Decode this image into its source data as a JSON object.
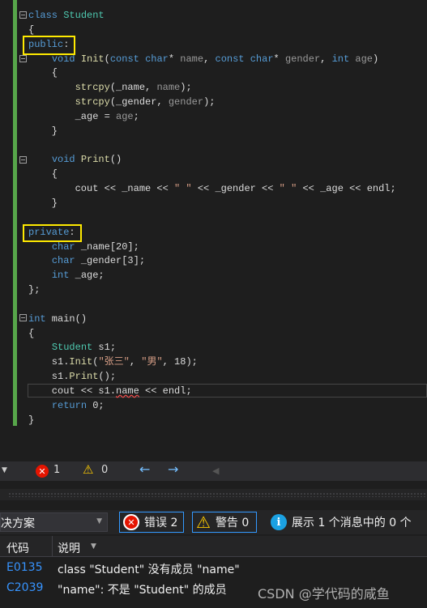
{
  "code_lines": [
    "class Student",
    "{",
    "public:",
    "    void Init(const char* name, const char* gender, int age)",
    "    {",
    "        strcpy(_name, name);",
    "        strcpy(_gender, gender);",
    "        _age = age;",
    "    }",
    "",
    "    void Print()",
    "    {",
    "        cout << _name << \" \" << _gender << \" \" << _age << endl;",
    "    }",
    "",
    "private:",
    "    char _name[20];",
    "    char _gender[3];",
    "    int _age;",
    "};",
    "",
    "int main()",
    "{",
    "    Student s1;",
    "    s1.Init(\"张三\", \"男\", 18);",
    "    s1.Print();",
    "    cout << s1.name << endl;",
    "    return 0;",
    "}"
  ],
  "toolbar": {
    "errors": "1",
    "warnings": "0",
    "back_icon": "arrow-left-icon",
    "forward_icon": "arrow-right-icon"
  },
  "error_list": {
    "scope": "决方案",
    "errors_label": "错误 2",
    "warnings_label": "警告 0",
    "messages_label": "展示 1 个消息中的 0 个",
    "columns": [
      "代码",
      "说明"
    ],
    "rows": [
      {
        "code": "E0135",
        "description": "class \"Student\" 没有成员 \"name\""
      },
      {
        "code": "C2039",
        "description": "\"name\": 不是 \"Student\" 的成员"
      }
    ]
  },
  "watermark": "CSDN @学代码的咸鱼",
  "colors": {
    "keyword": "#569cd6",
    "type": "#4ec9b0",
    "function": "#dcdcaa",
    "highlight": "#ffea00",
    "link": "#3794ff"
  }
}
